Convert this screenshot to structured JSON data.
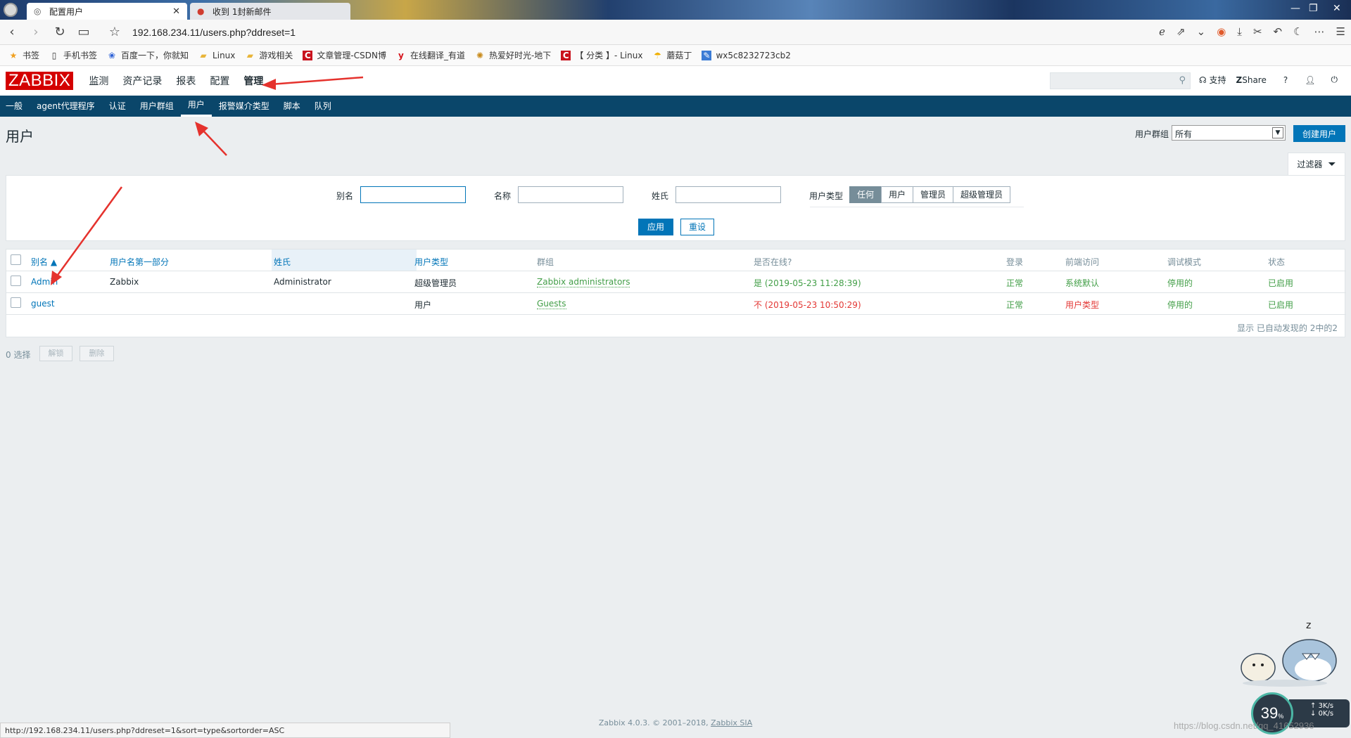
{
  "browser": {
    "tabs": [
      {
        "title": "配置用户",
        "active": true
      },
      {
        "title": "收到 1封新邮件",
        "active": false
      }
    ],
    "url": "192.168.234.11/users.php?ddreset=1",
    "bookmarks": [
      {
        "label": "书签",
        "icon": "star-icon"
      },
      {
        "label": "手机书签",
        "icon": "phone-icon"
      },
      {
        "label": "百度一下，你就知",
        "icon": "baidu-icon"
      },
      {
        "label": "Linux",
        "icon": "folder-icon"
      },
      {
        "label": "游戏相关",
        "icon": "folder-icon"
      },
      {
        "label": "文章管理-CSDN博",
        "icon": "csdn-icon"
      },
      {
        "label": "在线翻译_有道",
        "icon": "youdao-icon"
      },
      {
        "label": "热爱好时光-地下",
        "icon": "site-icon"
      },
      {
        "label": "【 分类 】- Linux",
        "icon": "csdn-icon"
      },
      {
        "label": "蘑菇丁",
        "icon": "mushroom-icon"
      },
      {
        "label": "wx5c8232723cb2",
        "icon": "site-icon"
      }
    ],
    "status_url": "http://192.168.234.11/users.php?ddreset=1&sort=type&sortorder=ASC"
  },
  "zabbix": {
    "logo": "ZABBIX",
    "top_menu": [
      "监测",
      "资产记录",
      "报表",
      "配置",
      "管理"
    ],
    "top_menu_selected": 4,
    "support": "支持",
    "share": "Share",
    "help": "?",
    "sub_menu": [
      "一般",
      "agent代理程序",
      "认证",
      "用户群组",
      "用户",
      "报警媒介类型",
      "脚本",
      "队列"
    ],
    "sub_menu_selected": 4
  },
  "page": {
    "title": "用户",
    "user_group_label": "用户群组",
    "user_group_value": "所有",
    "create_button": "创建用户"
  },
  "filter": {
    "tab_label": "过滤器",
    "alias_label": "别名",
    "alias_value": "",
    "name_label": "名称",
    "name_value": "",
    "surname_label": "姓氏",
    "surname_value": "",
    "type_label": "用户类型",
    "type_options": [
      "任何",
      "用户",
      "管理员",
      "超级管理员"
    ],
    "type_selected": 0,
    "apply": "应用",
    "reset": "重设"
  },
  "table": {
    "headers": [
      "别名 ▲",
      "用户名第一部分",
      "姓氏",
      "用户类型",
      "群组",
      "是否在线?",
      "登录",
      "前端访问",
      "调试模式",
      "状态"
    ],
    "rows": [
      {
        "alias": "Admin",
        "name": "Zabbix",
        "surname": "Administrator",
        "type": "超级管理员",
        "group": "Zabbix administrators",
        "online": "是 (2019-05-23 11:28:39)",
        "online_status": "yes",
        "login": "正常",
        "frontend": "系统默认",
        "frontend_status": "default",
        "debug": "停用的",
        "status": "已启用"
      },
      {
        "alias": "guest",
        "name": "",
        "surname": "",
        "type": "用户",
        "group": "Guests",
        "online": "不 (2019-05-23 10:50:29)",
        "online_status": "no",
        "login": "正常",
        "frontend": "用户类型",
        "frontend_status": "type",
        "debug": "停用的",
        "status": "已启用"
      }
    ],
    "footer": "显示 已自动发现的 2中的2"
  },
  "actions": {
    "selected_count": "0 选择",
    "unblock": "解锁",
    "delete": "删除"
  },
  "footer": {
    "text": "Zabbix 4.0.3. © 2001–2018,",
    "link": "Zabbix SIA"
  },
  "overlay": {
    "cpu_percent": "39",
    "cpu_unit": "%",
    "net_up": "3K/s",
    "net_down": "0K/s",
    "watermark": "https://blog.csdn.net/qq_41652936"
  },
  "colors": {
    "zabbix_red": "#d40000",
    "subnav_blue": "#0a466a",
    "primary_blue": "#0275b8",
    "green": "#429e47",
    "red": "#e33734",
    "annotation_arrow": "#e5322d"
  }
}
